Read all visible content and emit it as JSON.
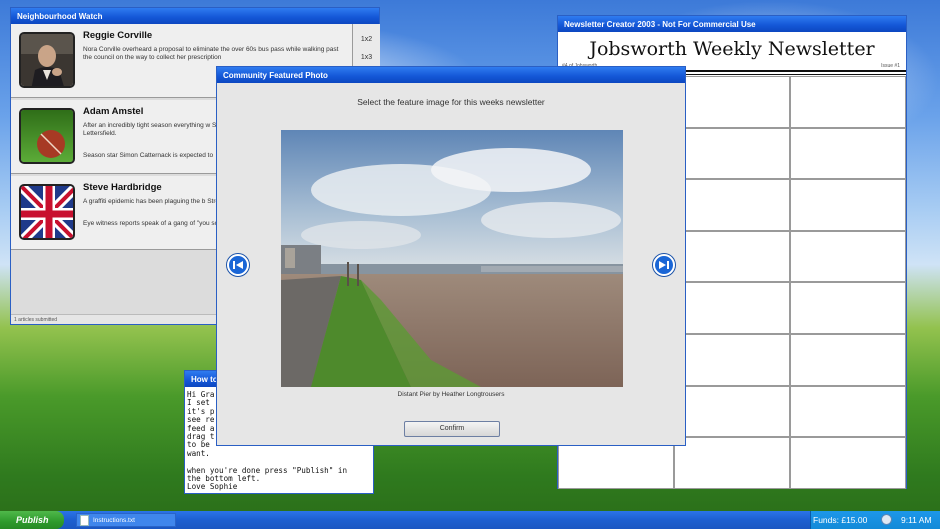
{
  "desktop": {
    "background": "bliss-like wallpaper"
  },
  "neighbourhood_watch": {
    "title": "Neighbourhood Watch",
    "items": [
      {
        "name": "Reggie Corville",
        "text": "Nora Corville overheard a proposal to eliminate the over 60s bus pass while walking past the council on the way to collect her prescription",
        "text2": "",
        "tag": "1x2",
        "icon": "portrait-thumbnail"
      },
      {
        "name": "Adam Amstel",
        "text": "After an incredibly tight season everything w South East Cup\" as the Giants of Jobsworth Lettersfield.",
        "text2": "Season star Simon Catternack is expected to",
        "tag": "1x3",
        "icon": "cricket-ball-thumbnail"
      },
      {
        "name": "Steve Hardbridge",
        "text": "A graffiti epidemic has been plaguing the b Street.",
        "text2": "Eye witness reports speak of a gang of \"you some misspelt vulgarity.",
        "tag": "",
        "icon": "union-jack-thumbnail"
      }
    ],
    "status": "1 articles submitted"
  },
  "newsletter": {
    "title": "Newsletter Creator 2003 - Not For Commercial Use",
    "masthead": "Jobsworth Weekly Newsletter",
    "subline": "#4 of Jobsworth",
    "issue": "Issue #1"
  },
  "instructions": {
    "title": "How to",
    "body": "Hi Gra\nI set\nit's p\nsee re\nfeed a\ndrag t\nto be\nwant.\n\nwhen you're done press \"Publish\" in\nthe bottom left.\nLove Sophie"
  },
  "featured_photo": {
    "title": "Community Featured Photo",
    "instruction": "Select the feature image for this weeks newsletter",
    "caption": "Distant Pier by Heather Longtrousers",
    "confirm_label": "Confirm",
    "prev_icon": "skip-back-icon",
    "next_icon": "skip-forward-icon"
  },
  "taskbar": {
    "start_label": "Publish",
    "task_label": "Instructions.txt",
    "funds": "Funds: £15.00",
    "clock": "9:11 AM"
  },
  "colors": {
    "title_bar": "#1356d6",
    "taskbar": "#1d5fd0",
    "start": "#2e9a2c",
    "tray": "#138ad8"
  }
}
